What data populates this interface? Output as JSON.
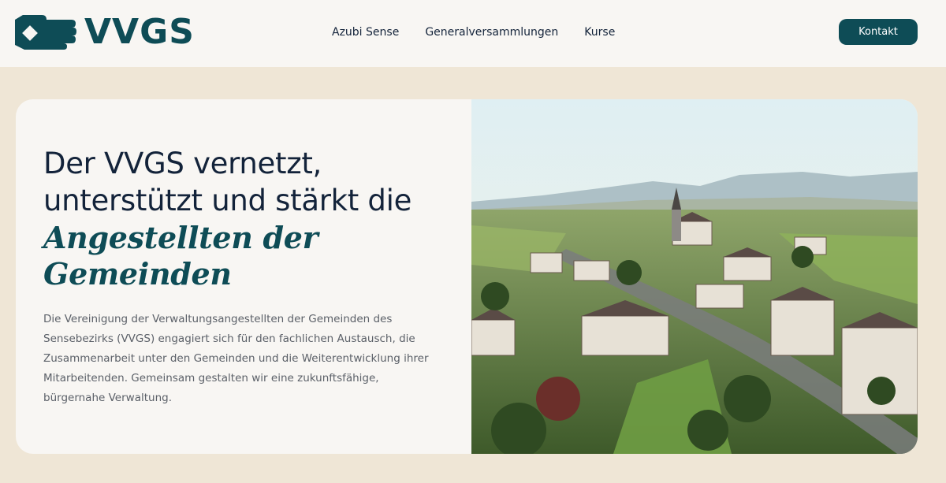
{
  "brand": {
    "name": "VVGS",
    "color": "#0e4c56"
  },
  "nav": {
    "items": [
      {
        "label": "Azubi Sense"
      },
      {
        "label": "Generalversammlungen"
      },
      {
        "label": "Kurse"
      }
    ]
  },
  "header": {
    "contact_label": "Kontakt"
  },
  "hero": {
    "headline_line1": "Der VVGS vernetzt,",
    "headline_line2": "unterstützt und stärkt die",
    "headline_accent_line1": "Angestellten der",
    "headline_accent_line2": "Gemeinden",
    "description": "Die Vereinigung der Verwaltungsangestellten der Gemeinden des Sensebezirks (VVGS) engagiert sich für den fachlichen Austausch, die Zusammenarbeit unter den Gemeinden und die Weiterentwicklung ihrer Mitarbeitenden. Gemeinsam gestalten wir eine zukunftsfähige, bürgernahe Verwaltung.",
    "image_icon": "aerial-village-photo"
  },
  "colors": {
    "background": "#efe6d6",
    "surface": "#f8f6f3",
    "accent": "#0e4c56",
    "text": "#13233a"
  }
}
